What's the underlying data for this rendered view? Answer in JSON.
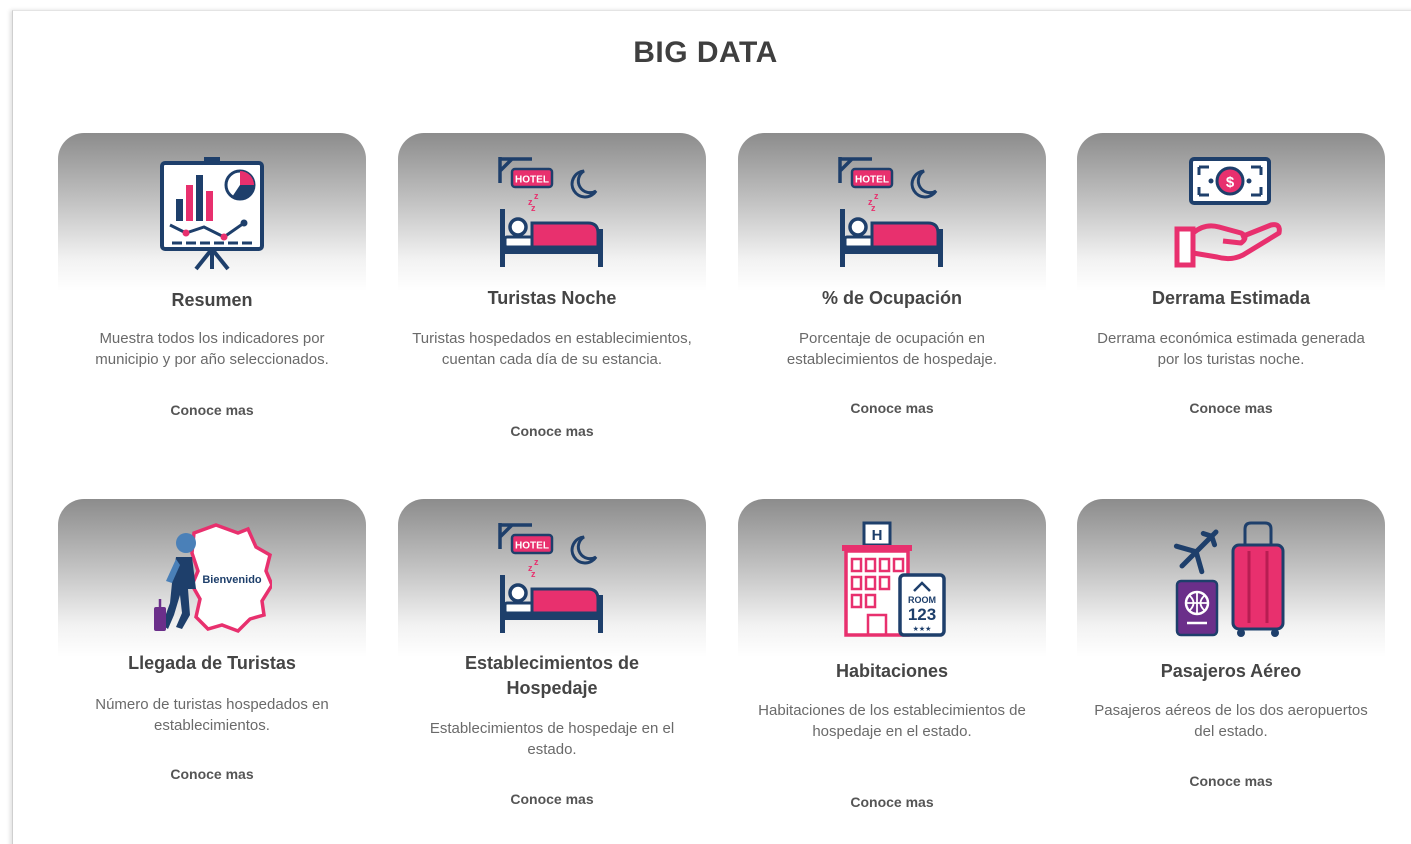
{
  "page": {
    "title": "BIG DATA"
  },
  "colors": {
    "navy": "#1e3f6b",
    "pink": "#e8306e",
    "purple": "#6b2f8a",
    "title": "#3f3f3f"
  },
  "cards": [
    {
      "icon": "presentation-chart-icon",
      "title": "Resumen",
      "description": "Muestra todos los indicadores por municipio y por año seleccionados.",
      "link": "Conoce mas"
    },
    {
      "icon": "hotel-bed-icon",
      "title": "Turistas Noche",
      "description": "Turistas hospedados en establecimientos, cuentan cada día de su estancia.",
      "link": "Conoce mas",
      "badge": "HOTEL"
    },
    {
      "icon": "hotel-bed-icon",
      "title": "% de Ocupación",
      "description": "Porcentaje de ocupación en establecimientos de hospedaje.",
      "link": "Conoce mas",
      "badge": "HOTEL"
    },
    {
      "icon": "money-hand-icon",
      "title": "Derrama Estimada",
      "description": "Derrama económica estimada generada por los turistas noche.",
      "link": "Conoce mas"
    },
    {
      "icon": "traveler-map-icon",
      "title": "Llegada de Turistas",
      "description": "Número de turistas hospedados en establecimientos.",
      "link": "Conoce mas",
      "badge": "Bienvenido"
    },
    {
      "icon": "hotel-bed-icon",
      "title": "Establecimientos de Hospedaje",
      "description": "Establecimientos de hospedaje en el estado.",
      "link": "Conoce mas",
      "badge": "HOTEL"
    },
    {
      "icon": "hotel-building-icon",
      "title": "Habitaciones",
      "description": "Habitaciones de los establecimientos de hospedaje en el estado.",
      "link": "Conoce mas",
      "badge": "ROOM",
      "room_number": "123",
      "stars": "★★★",
      "sign": "H"
    },
    {
      "icon": "airplane-luggage-icon",
      "title": "Pasajeros Aéreo",
      "description": "Pasajeros aéreos de los dos aeropuertos del estado.",
      "link": "Conoce mas"
    }
  ]
}
